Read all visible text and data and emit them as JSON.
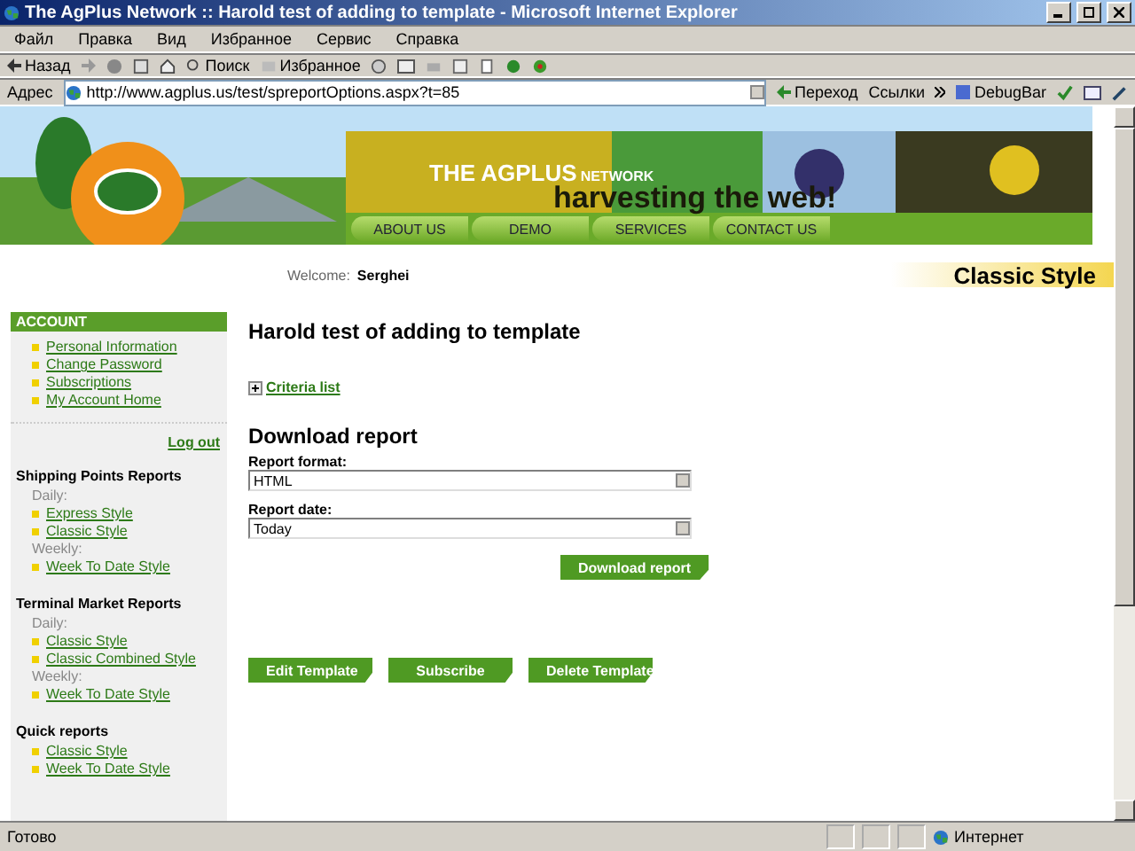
{
  "window": {
    "title": "The AgPlus Network :: Harold test of adding to template - Microsoft Internet Explorer"
  },
  "menu": [
    "Файл",
    "Правка",
    "Вид",
    "Избранное",
    "Сервис",
    "Справка"
  ],
  "toolbar": {
    "back": "Назад",
    "search": "Поиск",
    "favorites": "Избранное"
  },
  "address_bar": {
    "label": "Адрес",
    "url": "http://www.agplus.us/test/spreportOptions.aspx?t=85",
    "go": "Переход",
    "links": "Ссылки",
    "debugbar": "DebugBar"
  },
  "banner": {
    "brand": "THE AGPLUS",
    "brand_suffix": "NETWORK",
    "slogan": "harvesting the web!"
  },
  "nav": [
    "ABOUT US",
    "DEMO",
    "SERVICES",
    "CONTACT US"
  ],
  "welcome": {
    "label": "Welcome:",
    "user": "Serghei",
    "style_title": "Classic Style"
  },
  "sidebar": {
    "account": {
      "heading": "ACCOUNT",
      "links": [
        "Personal Information",
        "Change Password",
        "Subscriptions",
        "My Account Home"
      ],
      "logout": "Log out"
    },
    "sections": [
      {
        "title": "Shipping Points Reports",
        "items": [
          {
            "kind": "label",
            "text": "Daily:"
          },
          {
            "kind": "link",
            "text": "Express Style"
          },
          {
            "kind": "link",
            "text": "Classic Style"
          },
          {
            "kind": "label",
            "text": "Weekly:"
          },
          {
            "kind": "link",
            "text": "Week To Date Style"
          }
        ]
      },
      {
        "title": "Terminal Market Reports",
        "items": [
          {
            "kind": "label",
            "text": "Daily:"
          },
          {
            "kind": "link",
            "text": "Classic Style"
          },
          {
            "kind": "link",
            "text": "Classic Combined Style"
          },
          {
            "kind": "label",
            "text": "Weekly:"
          },
          {
            "kind": "link",
            "text": "Week To Date Style"
          }
        ]
      },
      {
        "title": "Quick reports",
        "items": [
          {
            "kind": "link",
            "text": "Classic Style"
          },
          {
            "kind": "link",
            "text": "Week To Date Style"
          }
        ]
      }
    ]
  },
  "main": {
    "title": "Harold test of adding to template",
    "criteria": {
      "label": "Criteria list",
      "expanded": false
    },
    "download_heading": "Download report",
    "fields": [
      {
        "label": "Report format:",
        "value": "HTML"
      },
      {
        "label": "Report date:",
        "value": "Today"
      }
    ],
    "download_button": "Download report",
    "actions": [
      "Edit Template",
      "Subscribe",
      "Delete Template"
    ]
  },
  "status_bar": {
    "text": "Готово",
    "zone": "Интернет"
  }
}
